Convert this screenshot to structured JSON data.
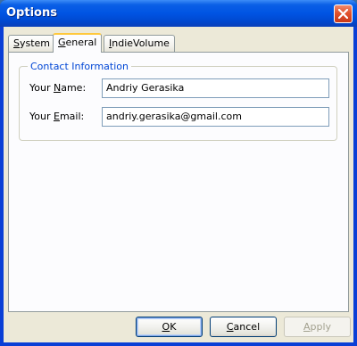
{
  "window": {
    "title": "Options"
  },
  "tabs": [
    {
      "label": "System",
      "mnemonic": "S",
      "rest": "ystem",
      "active": false
    },
    {
      "label": "General",
      "mnemonic": "G",
      "rest": "eneral",
      "active": true
    },
    {
      "label": "IndieVolume",
      "mnemonic": "I",
      "rest": "ndieVolume",
      "active": false
    }
  ],
  "contact": {
    "legend": "Contact Information",
    "name_label_pre": "Your ",
    "name_label_mn": "N",
    "name_label_post": "ame:",
    "name_value": "Andriy Gerasika",
    "email_label_pre": "Your ",
    "email_label_mn": "E",
    "email_label_post": "mail:",
    "email_value": "andriy.gerasika@gmail.com"
  },
  "buttons": {
    "ok_mn": "O",
    "ok_rest": "K",
    "cancel_mn": "C",
    "cancel_rest": "ancel",
    "apply_mn": "A",
    "apply_rest": "pply"
  },
  "icons": {
    "close": "close-icon"
  },
  "colors": {
    "titlebar": "#0054e3",
    "accent_tab": "#ffc83c",
    "legend": "#0046d5",
    "close": "#e2522c"
  }
}
